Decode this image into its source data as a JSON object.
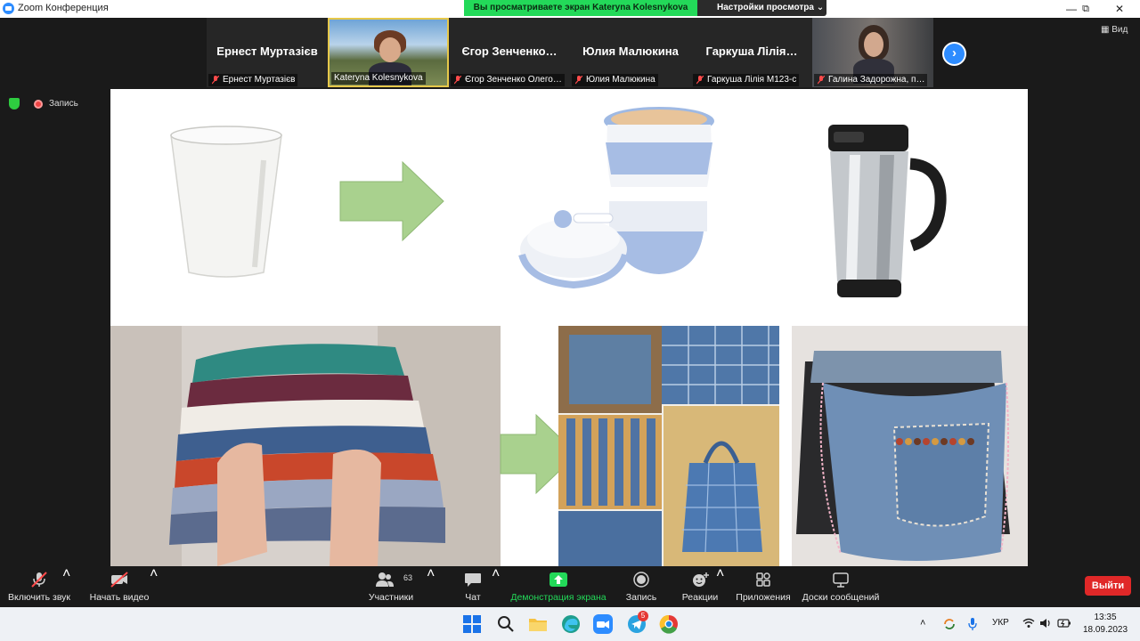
{
  "window": {
    "title": "Zoom Конференция",
    "minimize_icon": "—",
    "maximize_icon": "⧉",
    "close_icon": "✕"
  },
  "share_banner": {
    "status": "Вы просматриваете экран Kateryna Kolesnykova",
    "view_settings": "Настройки просмотра ⌄"
  },
  "participants": [
    {
      "display": "Ернест Муртазієв",
      "caption": "Ернест Муртазієв",
      "video": false
    },
    {
      "display": "",
      "caption": "Kateryna Kolesnykova",
      "video": true,
      "active": true
    },
    {
      "display": "Єгор Зенченко…",
      "caption": "Єгор Зенченко Олего…",
      "video": false
    },
    {
      "display": "Юлия Малюкина",
      "caption": "Юлия Малюкина",
      "video": false
    },
    {
      "display": "Гаркуша Лілія…",
      "caption": "Гаркуша Лілія М123-с",
      "video": false
    },
    {
      "display": "",
      "caption": "Галина Задорожна, п…",
      "video": true
    }
  ],
  "strip": {
    "next_icon": "›",
    "view_label": "▦ Вид"
  },
  "recording": {
    "label": "Запись"
  },
  "toolbar": {
    "mute": "Включить звук",
    "video": "Начать видео",
    "participants": "Участники",
    "participants_count": "63",
    "chat": "Чат",
    "share": "Демонстрация экрана",
    "record": "Запись",
    "reactions": "Реакции",
    "apps": "Приложения",
    "whiteboards": "Доски сообщений",
    "leave": "Выйти",
    "caret": "˄"
  },
  "taskbar": {
    "telegram_badge": "5",
    "tray_caret": "˄",
    "language": "УКР",
    "time": "13:35",
    "date": "18.09.2023"
  },
  "colors": {
    "zoom_blue": "#2d8cff",
    "share_green": "#23d959",
    "leave_red": "#e02828",
    "arrow_green": "#a9d18e"
  }
}
